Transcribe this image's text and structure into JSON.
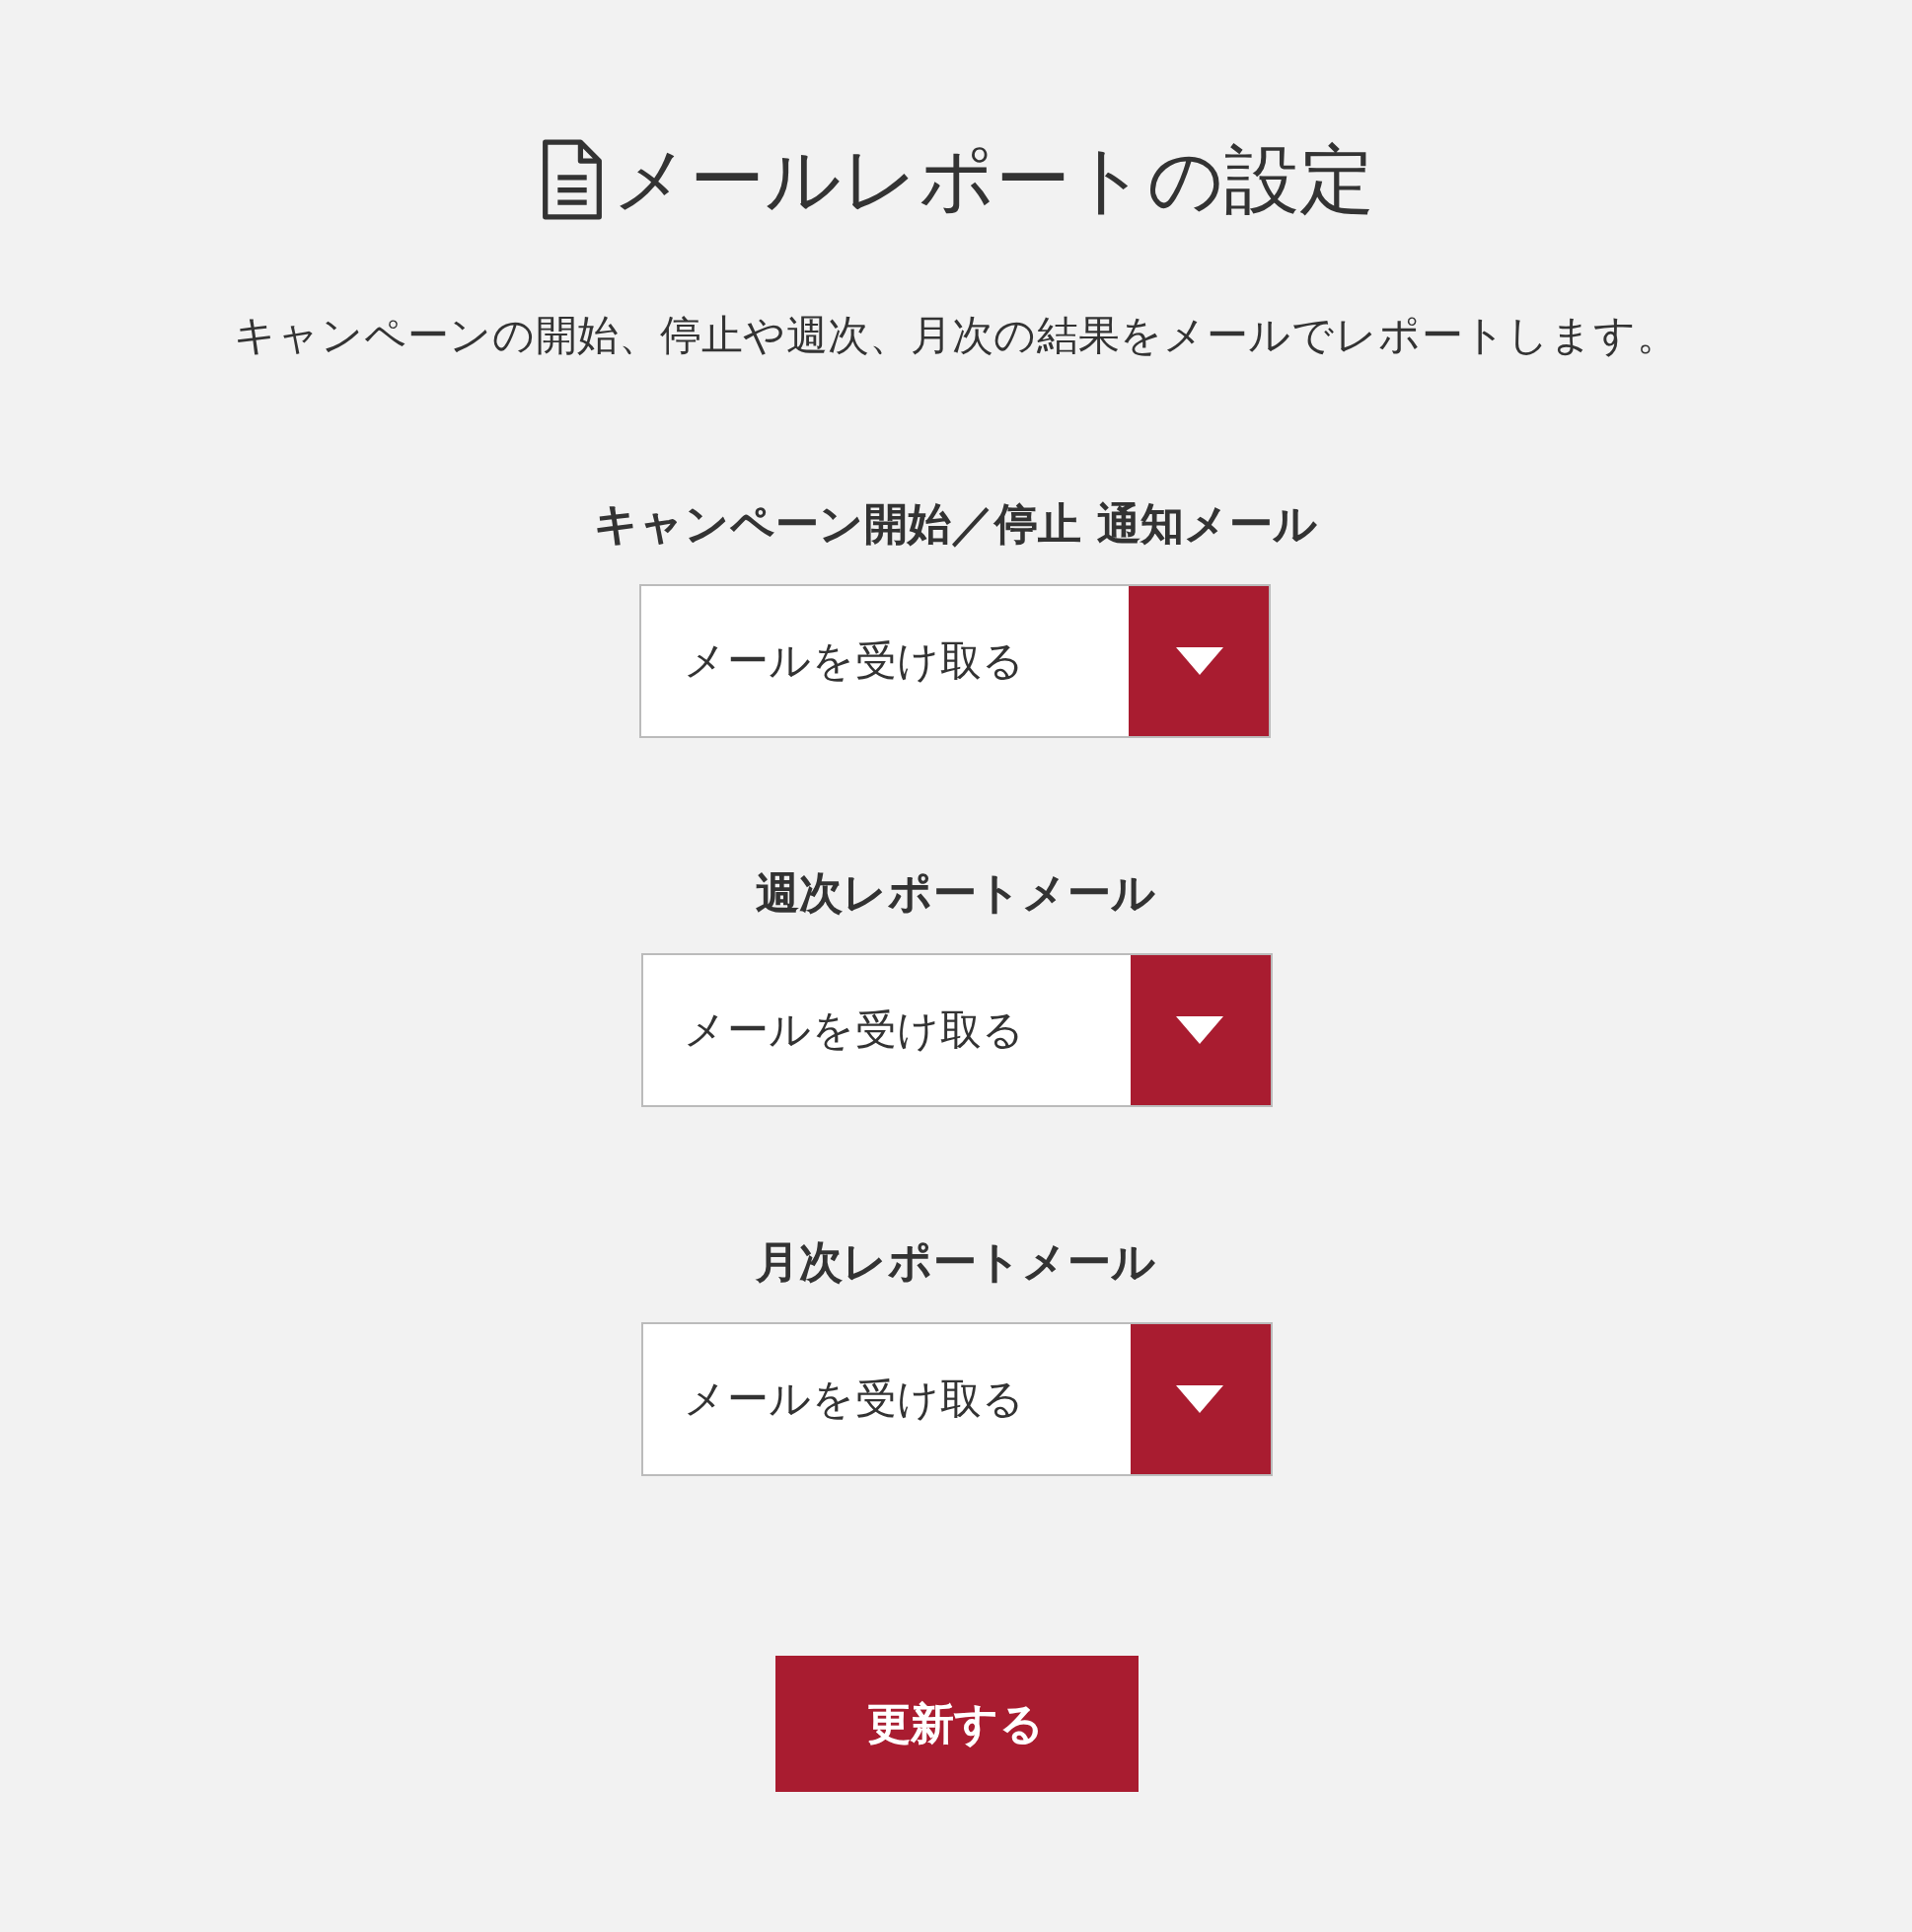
{
  "title": "メールレポートの設定",
  "description": "キャンペーンの開始、停止や週次、月次の結果をメールでレポートします。",
  "settings": [
    {
      "label": "キャンペーン開始／停止 通知メール",
      "value": "メールを受け取る"
    },
    {
      "label": "週次レポートメール",
      "value": "メールを受け取る"
    },
    {
      "label": "月次レポートメール",
      "value": "メールを受け取る"
    }
  ],
  "submit": "更新する"
}
